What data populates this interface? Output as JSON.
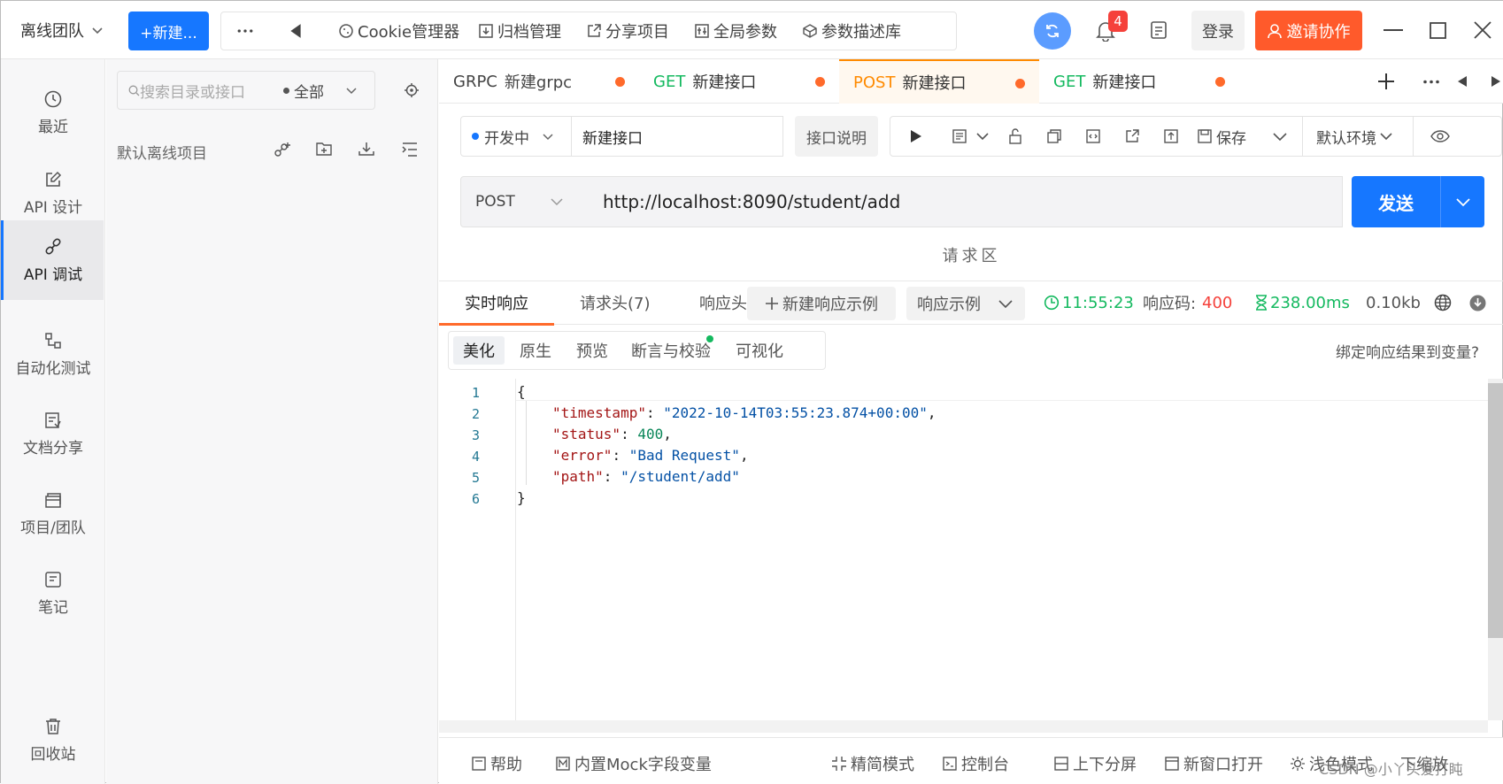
{
  "topbar": {
    "team": "离线团队",
    "new_btn": "+新建...",
    "tools": [
      "Cookie管理器",
      "归档管理",
      "分享项目",
      "全局参数",
      "参数描述库"
    ],
    "notification_count": "4",
    "login": "登录",
    "invite": "邀请协作"
  },
  "sidebar": {
    "items": [
      {
        "label": "最近",
        "icon": "clock-icon"
      },
      {
        "label": "API 设计",
        "icon": "edit-icon"
      },
      {
        "label": "API 调试",
        "icon": "link-icon"
      },
      {
        "label": "自动化测试",
        "icon": "flow-icon"
      },
      {
        "label": "文档分享",
        "icon": "doc-icon"
      },
      {
        "label": "项目/团队",
        "icon": "stack-icon"
      },
      {
        "label": "笔记",
        "icon": "note-icon"
      },
      {
        "label": "回收站",
        "icon": "trash-icon"
      }
    ],
    "active": "API 调试"
  },
  "project": {
    "search_placeholder": "搜索目录或接口",
    "filter": "全部",
    "name": "默认离线项目"
  },
  "tabs": [
    {
      "method": "GRPC",
      "name": "新建grpc"
    },
    {
      "method": "GET",
      "name": "新建接口"
    },
    {
      "method": "POST",
      "name": "新建接口"
    },
    {
      "method": "GET",
      "name": "新建接口"
    }
  ],
  "request": {
    "env_status": "开发中",
    "api_name": "新建接口",
    "api_doc": "接口说明",
    "save": "保存",
    "env": "默认环境",
    "method": "POST",
    "url": "http://localhost:8090/student/add",
    "send": "发送",
    "request_area": "请求区"
  },
  "response": {
    "tabs": [
      "实时响应",
      "请求头(7)",
      "响应头"
    ],
    "new_example": "新建响应示例",
    "example": "响应示例",
    "time": "11:55:23",
    "status_label": "响应码:",
    "status_code": "400",
    "duration": "238.00ms",
    "size": "0.10kb",
    "subtabs": [
      "美化",
      "原生",
      "预览",
      "断言与校验",
      "可视化"
    ],
    "bind_var": "绑定响应结果到变量?"
  },
  "code_lines": [
    {
      "n": "1",
      "text": "{"
    },
    {
      "n": "2",
      "key": "\"timestamp\"",
      "val": "\"2022-10-14T03:55:23.874+00:00\"",
      "type": "s"
    },
    {
      "n": "3",
      "key": "\"status\"",
      "val": "400",
      "type": "n"
    },
    {
      "n": "4",
      "key": "\"error\"",
      "val": "\"Bad Request\"",
      "type": "s"
    },
    {
      "n": "5",
      "key": "\"path\"",
      "val": "\"/student/add\"",
      "type": "s",
      "last": true
    },
    {
      "n": "6",
      "text": "}"
    }
  ],
  "footer": [
    "帮助",
    "内置Mock字段变量",
    "精简模式",
    "控制台",
    "上下分屏",
    "新窗口打开",
    "浅色模式",
    "下缩放"
  ],
  "watermark": "CSDN @小丫头爱打盹",
  "colors": {
    "accent": "#1677ff",
    "invite": "#ff5a2b",
    "get": "#14b95f",
    "post": "#ff8a00",
    "error": "#f5413b"
  }
}
